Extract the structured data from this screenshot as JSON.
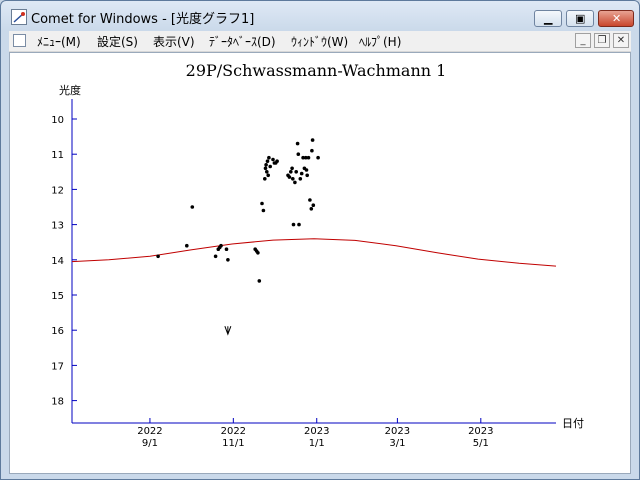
{
  "window": {
    "title": "Comet for Windows - [光度グラフ1]",
    "accent": "#c9462c"
  },
  "menu": {
    "items": [
      "ﾒﾆｭｰ(M)",
      "設定(S)",
      "表示(V)",
      "ﾃﾞｰﾀﾍﾞｰｽ(D)",
      "ｳｨﾝﾄﾞｳ(W)",
      "ﾍﾙﾌﾟ(H)"
    ]
  },
  "chart_data": {
    "type": "scatter",
    "title": "29P/Schwassmann-Wachmann 1",
    "ylabel": "光度",
    "xlabel": "日付",
    "ylim": [
      10,
      18
    ],
    "y_inverted": true,
    "y_ticks": [
      10,
      11,
      12,
      13,
      14,
      15,
      16,
      17,
      18
    ],
    "x_ticks": [
      {
        "line1": "2022",
        "line2": "9/1",
        "day": 0
      },
      {
        "line1": "2022",
        "line2": "11/1",
        "day": 61
      },
      {
        "line1": "2023",
        "line2": "1/1",
        "day": 122
      },
      {
        "line1": "2023",
        "line2": "3/1",
        "day": 181
      },
      {
        "line1": "2023",
        "line2": "5/1",
        "day": 242
      }
    ],
    "xlim_day": [
      -57,
      297
    ],
    "axis_color": "#0000c0",
    "curve_color": "#c00000",
    "point_color": "#000000",
    "series": [
      {
        "kind": "observed",
        "points": [
          [
            6,
            13.9
          ],
          [
            27,
            13.6
          ],
          [
            31,
            12.5
          ],
          [
            48,
            13.9
          ],
          [
            50,
            13.7
          ],
          [
            51,
            13.65
          ],
          [
            52,
            13.6
          ],
          [
            56,
            13.7
          ],
          [
            57,
            14.0
          ],
          [
            77,
            13.7
          ],
          [
            78,
            13.75
          ],
          [
            79,
            13.8
          ],
          [
            80,
            14.6
          ],
          [
            82,
            12.4
          ],
          [
            83,
            12.6
          ],
          [
            84,
            11.7
          ],
          [
            84.5,
            11.4
          ],
          [
            85,
            11.3
          ],
          [
            85.5,
            11.5
          ],
          [
            86,
            11.2
          ],
          [
            86.5,
            11.6
          ],
          [
            87,
            11.1
          ],
          [
            88,
            11.35
          ],
          [
            90,
            11.15
          ],
          [
            91,
            11.25
          ],
          [
            92,
            11.25
          ],
          [
            93,
            11.2
          ],
          [
            101,
            11.6
          ],
          [
            102,
            11.65
          ],
          [
            103,
            11.5
          ],
          [
            104,
            11.4
          ],
          [
            104.5,
            11.7
          ],
          [
            105,
            13.0
          ],
          [
            106,
            11.8
          ],
          [
            107,
            11.5
          ],
          [
            108,
            10.7
          ],
          [
            108.5,
            11.0
          ],
          [
            109,
            13.0
          ],
          [
            110,
            11.7
          ],
          [
            111,
            11.55
          ],
          [
            112,
            11.1
          ],
          [
            113,
            11.4
          ],
          [
            114,
            11.1
          ],
          [
            114.5,
            11.45
          ],
          [
            115,
            11.6
          ],
          [
            116,
            11.1
          ],
          [
            117,
            12.3
          ],
          [
            118,
            12.55
          ],
          [
            118.5,
            10.9
          ],
          [
            119,
            10.6
          ],
          [
            119.5,
            12.45
          ],
          [
            123,
            11.1
          ]
        ]
      },
      {
        "kind": "upper-limit",
        "points": [
          [
            57,
            16.0
          ]
        ]
      },
      {
        "kind": "predicted",
        "points": [
          [
            -57,
            14.05
          ],
          [
            -30,
            14.0
          ],
          [
            0,
            13.9
          ],
          [
            30,
            13.72
          ],
          [
            60,
            13.55
          ],
          [
            90,
            13.44
          ],
          [
            120,
            13.4
          ],
          [
            150,
            13.45
          ],
          [
            180,
            13.6
          ],
          [
            210,
            13.8
          ],
          [
            240,
            13.98
          ],
          [
            270,
            14.1
          ],
          [
            297,
            14.18
          ]
        ]
      }
    ]
  }
}
